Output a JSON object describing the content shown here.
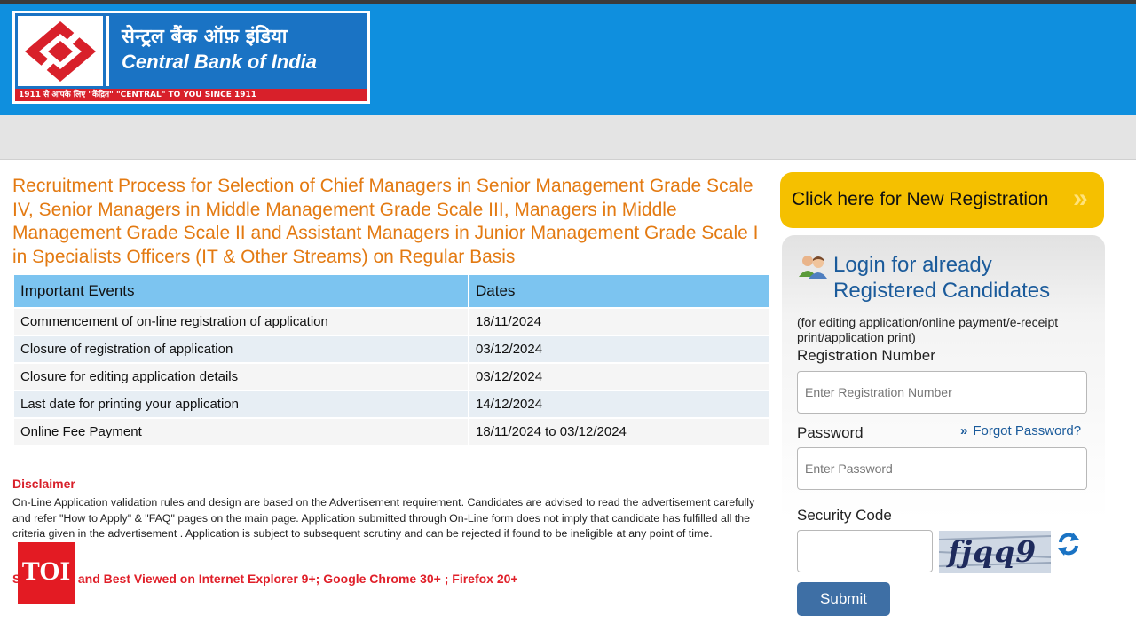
{
  "header": {
    "logo": {
      "hindi_name": "सेन्ट्रल बैंक ऑफ़ इंडिया",
      "english_name": "Central Bank of India",
      "tagline": "1911 से आपके लिए \"केंद्रित\"   \"CENTRAL\" TO YOU SINCE 1911"
    },
    "colors": {
      "header_blue": "#0f8fde",
      "logo_blue": "#1a73c4",
      "brand_red": "#d8202a"
    }
  },
  "main": {
    "title": "Recruitment Process for Selection of Chief Managers in Senior Management Grade Scale IV, Senior Managers in Middle Management Grade Scale III, Managers in Middle Management Grade Scale II and Assistant Managers in Junior Management Grade Scale I in Specialists Officers (IT & Other Streams) on Regular Basis",
    "events_table": {
      "headers": [
        "Important Events",
        "Dates"
      ],
      "rows": [
        [
          "Commencement of on-line registration of application",
          "18/11/2024"
        ],
        [
          "Closure of registration of application",
          "03/12/2024"
        ],
        [
          "Closure for editing application details",
          "03/12/2024"
        ],
        [
          "Last date for printing your application",
          "14/12/2024"
        ],
        [
          "Online Fee Payment",
          "18/11/2024 to 03/12/2024"
        ]
      ]
    },
    "disclaimer": {
      "title": "Disclaimer",
      "text": "On-Line Application validation rules and design are based on the Advertisement requirement. Candidates are advised to read the advertisement carefully and refer \"How to Apply\" & \"FAQ\" pages on the main page. Application submitted through On-Line form does not imply that candidate has fulfilled all the criteria given in the advertisement . Application is subject to subsequent scrutiny and can be rejected if found to be ineligible at any point of time."
    },
    "browser_note": "Supported and Best Viewed on Internet Explorer 9+; Google Chrome 30+ ; Firefox 20+",
    "watermark": "TOI"
  },
  "sidebar": {
    "new_registration": {
      "label": "Click here for New Registration",
      "arrow": "»"
    },
    "login": {
      "title": "Login for already Registered Candidates",
      "note": "(for editing application/online payment/e-receipt print/application print)",
      "registration_label": "Registration Number",
      "registration_placeholder": "Enter Registration Number",
      "password_label": "Password",
      "forgot_arrow": "»",
      "forgot_label": "Forgot Password?",
      "password_placeholder": "Enter Password",
      "security_label": "Security Code",
      "security_value": "",
      "captcha_text": "fjqq9",
      "refresh_icon": "refresh-icon",
      "submit_label": "Submit"
    },
    "colors": {
      "button_yellow": "#f5c000",
      "submit_blue": "#3e6fa5",
      "link_blue": "#1b5b9b"
    }
  }
}
